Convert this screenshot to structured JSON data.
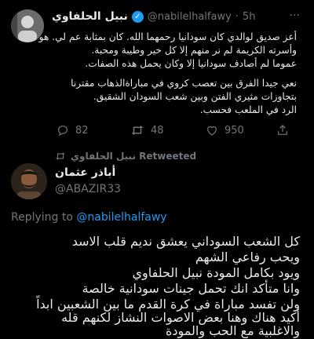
{
  "tweet": {
    "author_name": "نبيل الحلفاوي",
    "handle": "@nabilelhalfawy",
    "separator": "·",
    "time": "5h",
    "more": "···",
    "lines": [
      "أعز صديق لوالدي كان سودانيا رحمهما الله. كان بمثابة عم لي. هو",
      "وأسرته الكريمة لم نر منهم إلا كل خير وطيبة ومحبة.",
      "عموما لم أصادف سودانيا إلا وكان يحمل هذه الصفات.",
      "نعي جيدا الفرق بين تعصب كروي في مباراةالذهاب مقترنا",
      "بتجاوزات مثيري الفتن وبين شعب السودان الشقيق.",
      "الرد في الملعب فحسب."
    ],
    "replies": "82",
    "retweets": "48",
    "likes": "950"
  },
  "retweet_banner": {
    "text": "نبيل الحلفاوي Retweeted"
  },
  "reply": {
    "author_name": "أباذر عثمان",
    "handle": "@ABAZIR33",
    "replying_prefix": "Replying to",
    "replying_handle": "@nabilelhalfawy",
    "lines": [
      "كل الشعب السوداني يعشق نديم قلب الاسد",
      "ويحب رفاعي الشهم",
      "ويود بكامل المودة نبيل الحلفاوي",
      "وانا متأكد انك تحمل جينات سودانية خالصة",
      "ولن تفسد مباراة في كرة القدم ما بين الشعبين ابداً",
      "أكيد هناك وهنا بعض الاصوات النشاز لكنهم قله",
      "والاغلبية مع الحب والمودة"
    ]
  }
}
